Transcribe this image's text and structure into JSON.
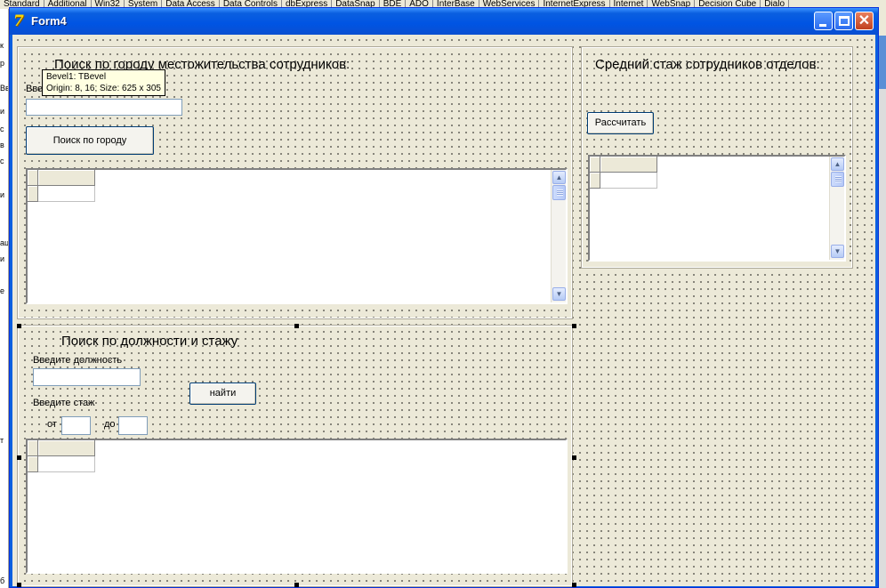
{
  "palette_tabs": [
    "Standard",
    "Additional",
    "Win32",
    "System",
    "Data Access",
    "Data Controls",
    "dbExpress",
    "DataSnap",
    "BDE",
    "ADO",
    "InterBase",
    "WebServices",
    "InternetExpress",
    "Internet",
    "WebSnap",
    "Decision Cube",
    "Dialo"
  ],
  "left_sliver_fragments": [
    "к",
    "р",
    "Вве",
    "и",
    "с",
    "в",
    "с",
    "и",
    "ац",
    "и",
    "e",
    "т",
    "б"
  ],
  "window": {
    "title": "Form4",
    "app_icon": "delphi-7-icon",
    "controls": [
      "minimize-icon",
      "maximize-icon",
      "close-icon"
    ]
  },
  "city_panel": {
    "caption": "Поиск по городу местожительства сотрудников:",
    "input_label": "Вве",
    "input_value": "",
    "button_label": "Поиск по городу"
  },
  "hint": {
    "line1": "Bevel1: TBevel",
    "line2": "Origin: 8, 16; Size: 625 x 305"
  },
  "position_panel": {
    "caption": "Поиск по должности и стажу",
    "position_label": "Введите должность",
    "position_value": "",
    "experience_label": "Введите стаж",
    "from_label": "от",
    "to_label": "до",
    "from_value": "",
    "to_value": "",
    "button_label": "найти"
  },
  "dept_panel": {
    "caption": "Средний стаж сотрудников отделов:",
    "button_label": "Рассчитать"
  },
  "colors": {
    "title_bar": "#0054e3",
    "form_background": "#ece9d8",
    "close_button": "#c0401e"
  }
}
